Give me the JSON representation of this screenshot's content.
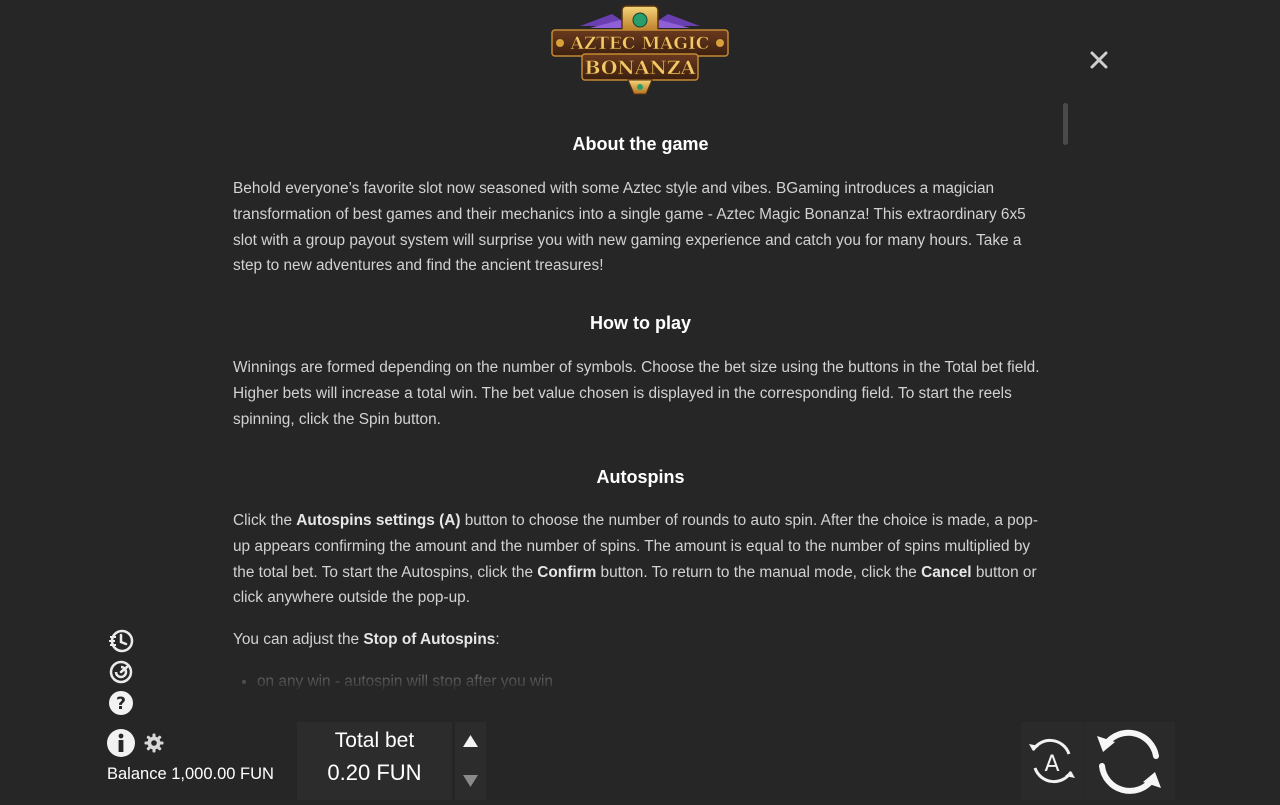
{
  "logo": {
    "line1": "AZTEC MAGIC",
    "line2": "BONANZA"
  },
  "close_icon": "✕",
  "sections": {
    "about": {
      "title": "About the game",
      "text": "Behold everyone’s favorite slot now seasoned with some Aztec style and vibes. BGaming introduces a magician transformation of best games and their mechanics into a single game - Aztec Magic Bonanza! This extraordinary 6x5 slot with a group payout system will surprise you with new gaming experience and catch you for many hours. Take a step to new adventures and find the ancient treasures!"
    },
    "how_to_play": {
      "title": "How to play",
      "text": "Winnings are formed depending on the number of symbols. Choose the bet size using the buttons in the Total bet field. Higher bets will increase a total win. The bet value chosen is displayed in the corresponding field. To start the reels spinning, click the Spin button."
    },
    "autospins": {
      "title": "Autospins",
      "p1_a": "Click the ",
      "p1_b": "Autospins settings (A)",
      "p1_c": " button to choose the number of rounds to auto spin. After the choice is made, a pop-up appears confirming the amount and the number of spins. The amount is equal to the number of spins multiplied by the total bet. To start the Autospins, click the ",
      "p1_d": "Confirm",
      "p1_e": " button. To return to the manual mode, click the ",
      "p1_f": "Cancel",
      "p1_g": " button or click anywhere outside the pop-up.",
      "p2_a": "You can adjust the ",
      "p2_b": "Stop of Autospins",
      "p2_c": ":",
      "bullets": [
        "on any win - autospin will stop after you win"
      ]
    }
  },
  "side_icons": [
    "fast-spin-icon",
    "turbo-icon",
    "help-icon",
    "info-icon",
    "gear-icon"
  ],
  "footer": {
    "balance_label": "Balance",
    "balance_value": "1,000.00 FUN",
    "total_bet_label": "Total bet",
    "total_bet_value": "0.20 FUN",
    "autospin_letter": "A"
  },
  "colors": {
    "background": "#262626",
    "text": "#d2d2d2",
    "heading": "#ffffff",
    "logo_gold": "#e8b14a",
    "logo_purple": "#6a3fb0"
  }
}
